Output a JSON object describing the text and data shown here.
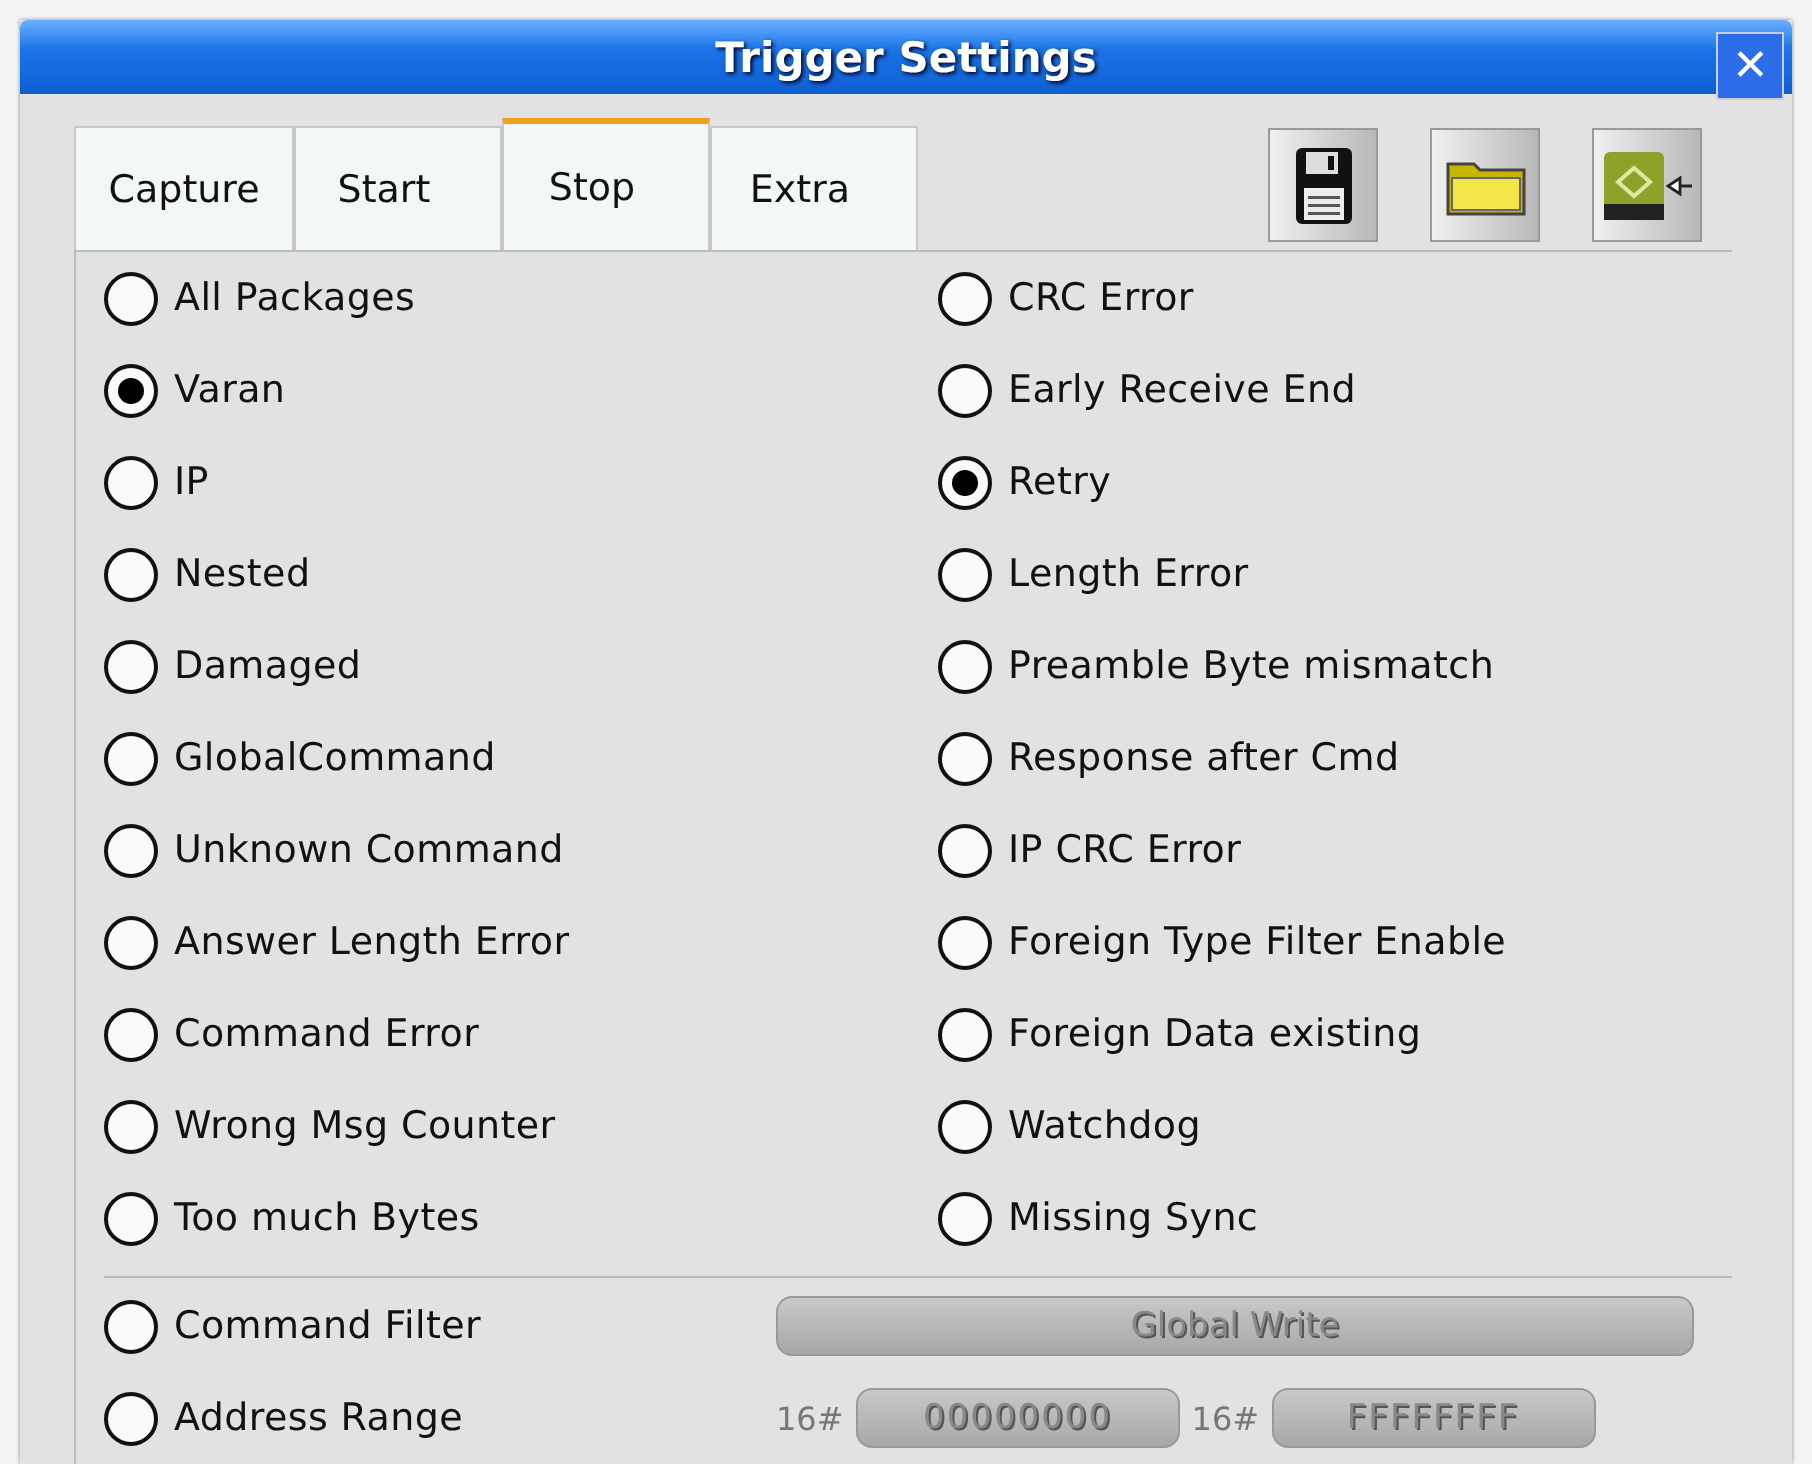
{
  "window": {
    "title": "Trigger Settings",
    "close": "✕"
  },
  "tabs": [
    {
      "label": "Capture",
      "selected": false
    },
    {
      "label": "Start",
      "selected": false
    },
    {
      "label": "Stop",
      "selected": true
    },
    {
      "label": "Extra",
      "selected": false
    }
  ],
  "toolbar": [
    {
      "kind": "save"
    },
    {
      "kind": "open"
    },
    {
      "kind": "import"
    }
  ],
  "options_left": [
    {
      "label": "All Packages",
      "selected": false
    },
    {
      "label": "Varan",
      "selected": true
    },
    {
      "label": "IP",
      "selected": false
    },
    {
      "label": "Nested",
      "selected": false
    },
    {
      "label": "Damaged",
      "selected": false
    },
    {
      "label": "GlobalCommand",
      "selected": false
    },
    {
      "label": "Unknown Command",
      "selected": false
    },
    {
      "label": "Answer Length Error",
      "selected": false
    },
    {
      "label": "Command Error",
      "selected": false
    },
    {
      "label": "Wrong Msg Counter",
      "selected": false
    },
    {
      "label": "Too much Bytes",
      "selected": false
    }
  ],
  "options_right": [
    {
      "label": "CRC Error",
      "selected": false
    },
    {
      "label": "Early Receive End",
      "selected": false
    },
    {
      "label": "Retry",
      "selected": true
    },
    {
      "label": "Length Error",
      "selected": false
    },
    {
      "label": "Preamble Byte mismatch",
      "selected": false
    },
    {
      "label": "Response after Cmd",
      "selected": false
    },
    {
      "label": "IP CRC Error",
      "selected": false
    },
    {
      "label": "Foreign Type Filter Enable",
      "selected": false
    },
    {
      "label": "Foreign Data existing",
      "selected": false
    },
    {
      "label": "Watchdog",
      "selected": false
    },
    {
      "label": "Missing Sync",
      "selected": false
    }
  ],
  "filters": [
    {
      "label": "Command Filter",
      "selected": false,
      "kind": "command",
      "button": {
        "label": "Global Write",
        "disabled": true
      }
    },
    {
      "label": "Address Range",
      "selected": false,
      "kind": "range",
      "fields": [
        {
          "prefix": "16#",
          "value": "00000000",
          "disabled": true
        },
        {
          "prefix": "16#",
          "value": "FFFFFFFF",
          "disabled": true
        }
      ]
    }
  ]
}
